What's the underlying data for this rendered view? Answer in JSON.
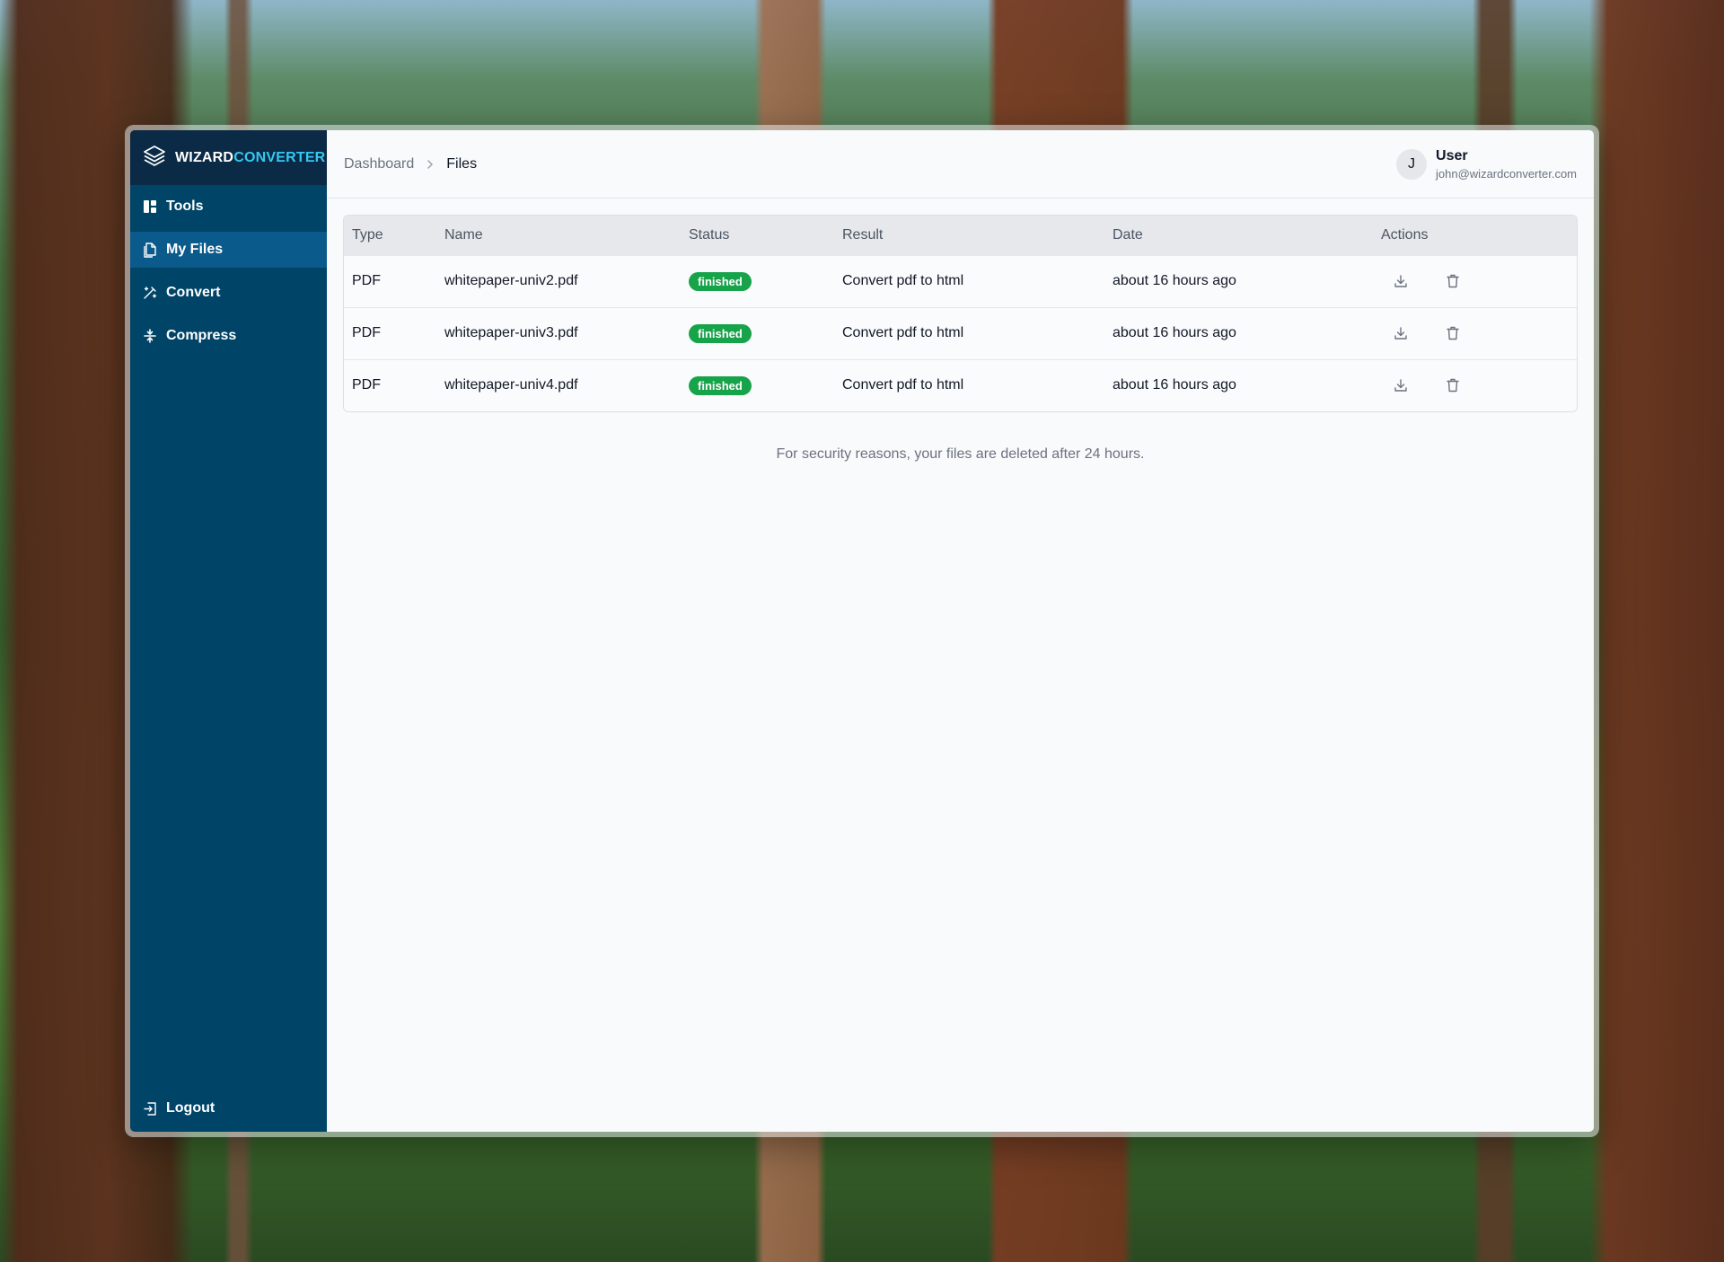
{
  "brand": {
    "name_part1": "WIZARD",
    "name_part2": "CONVERTER",
    "logo_icon": "layers-icon",
    "accent_color": "#38c7f0"
  },
  "sidebar": {
    "items": [
      {
        "label": "Tools",
        "icon": "grid-icon",
        "active": false
      },
      {
        "label": "My Files",
        "icon": "files-icon",
        "active": true
      },
      {
        "label": "Convert",
        "icon": "magic-wand-icon",
        "active": false
      },
      {
        "label": "Compress",
        "icon": "compress-icon",
        "active": false
      }
    ],
    "logout_label": "Logout",
    "logout_icon": "logout-icon",
    "color": "#004468"
  },
  "header": {
    "breadcrumb": {
      "parent": "Dashboard",
      "current": "Files"
    },
    "user": {
      "initial": "J",
      "name": "User",
      "email": "john@wizardconverter.com"
    }
  },
  "table": {
    "columns": [
      "Type",
      "Name",
      "Status",
      "Result",
      "Date",
      "Actions"
    ],
    "rows": [
      {
        "type": "PDF",
        "name": "whitepaper-univ2.pdf",
        "status": "finished",
        "result": "Convert pdf to html",
        "date": "about 16 hours ago"
      },
      {
        "type": "PDF",
        "name": "whitepaper-univ3.pdf",
        "status": "finished",
        "result": "Convert pdf to html",
        "date": "about 16 hours ago"
      },
      {
        "type": "PDF",
        "name": "whitepaper-univ4.pdf",
        "status": "finished",
        "result": "Convert pdf to html",
        "date": "about 16 hours ago"
      }
    ],
    "status_color": "#16a34a",
    "action_icons": [
      "download-icon",
      "trash-icon"
    ]
  },
  "footer_note": "For security reasons, your files are deleted after 24 hours."
}
